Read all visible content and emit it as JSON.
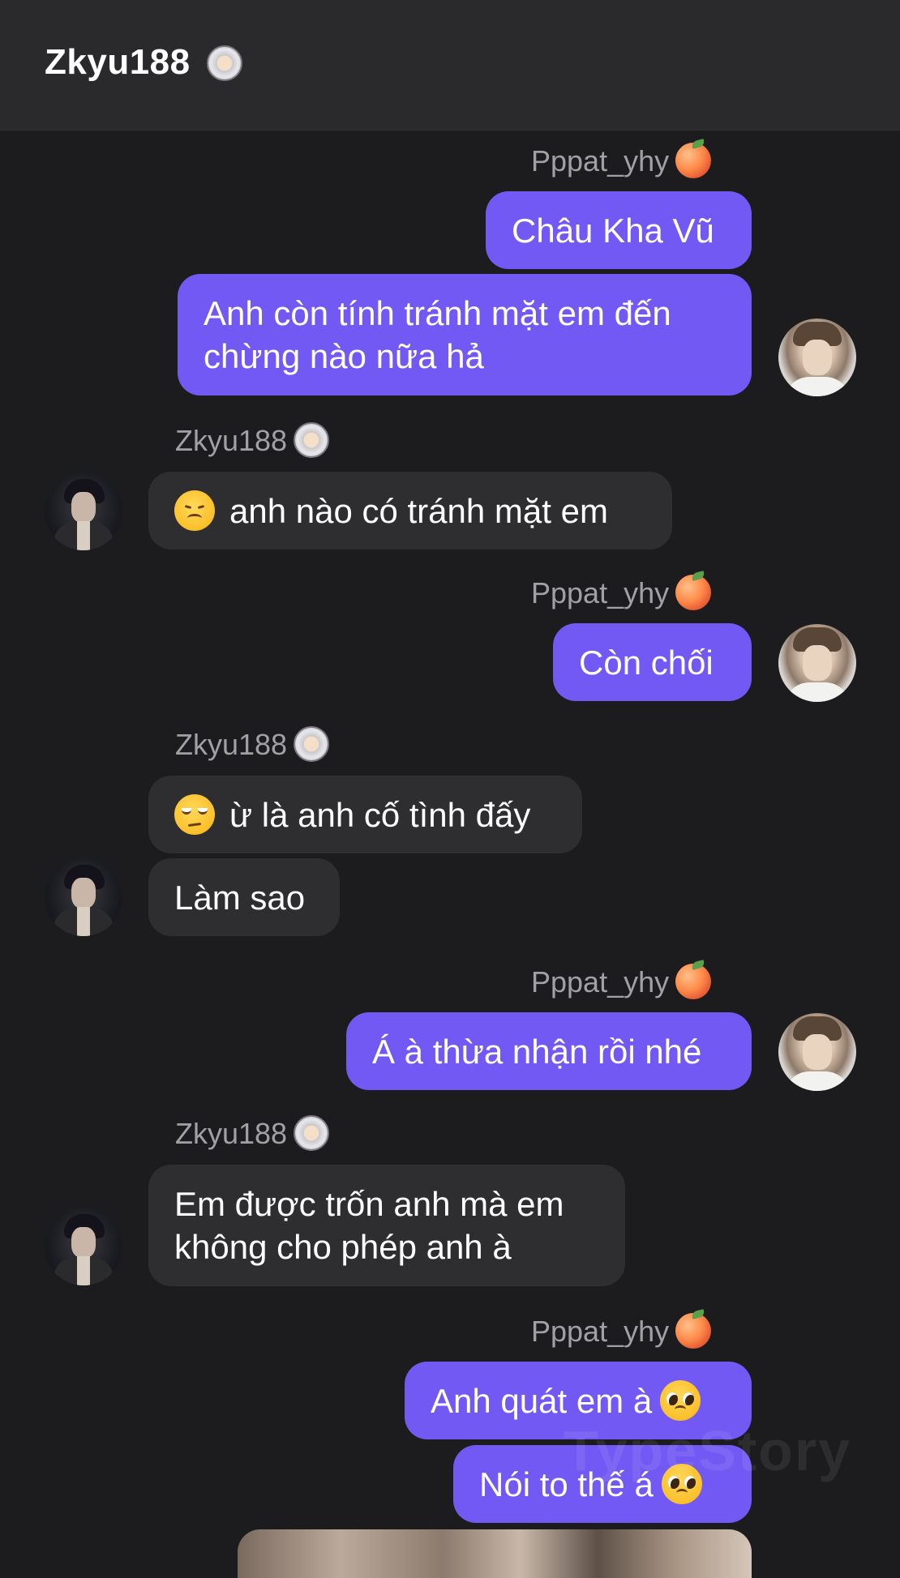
{
  "header": {
    "title": "Zkyu188",
    "title_icon": "astronaut-icon"
  },
  "users": {
    "me": {
      "name": "Pppat_yhy",
      "badge_icon": "peach-icon"
    },
    "him": {
      "name": "Zkyu188",
      "badge_icon": "astronaut-icon"
    }
  },
  "messages": [
    {
      "id": "m1",
      "side": "out",
      "text": "Châu Kha Vũ"
    },
    {
      "id": "m2",
      "side": "out",
      "text": "Anh còn tính tránh mặt em đến\nchừng nào nữa hả"
    },
    {
      "id": "m3",
      "side": "in",
      "text": "anh nào có tránh mặt em",
      "emoji": "disappointed-face-icon"
    },
    {
      "id": "m4",
      "side": "out",
      "text": "Còn chối"
    },
    {
      "id": "m5",
      "side": "in",
      "text": "ừ là anh cố tình đấy",
      "emoji": "unamused-face-icon"
    },
    {
      "id": "m6",
      "side": "in",
      "text": "Làm sao"
    },
    {
      "id": "m7",
      "side": "out",
      "text": "Á à thừa nhận rồi nhé"
    },
    {
      "id": "m8",
      "side": "in",
      "text": "Em được trốn anh mà em\nkhông cho phép anh à"
    },
    {
      "id": "m9",
      "side": "out",
      "text": "Anh quát em à",
      "emoji": "pleading-face-icon"
    },
    {
      "id": "m10",
      "side": "out",
      "text": "Nói to thế á",
      "emoji": "pleading-face-icon"
    }
  ],
  "watermark": "TypeStory",
  "colors": {
    "outgoing_bubble": "#7359f4",
    "incoming_bubble": "#2e2e30",
    "background": "#1c1c1e",
    "header": "#2a2a2c"
  }
}
